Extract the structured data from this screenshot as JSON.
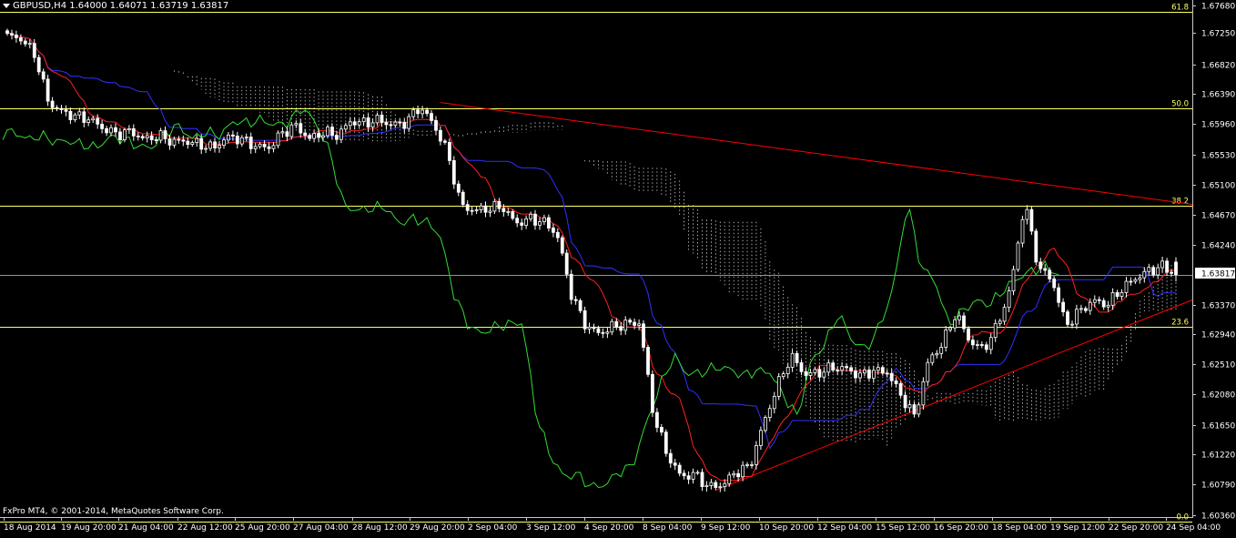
{
  "header": {
    "symbol_line": "GBPUSD,H4  1.64000 1.64071 1.63719 1.63817"
  },
  "footer": {
    "copyright": "FxPro MT4, © 2001-2014, MetaQuotes Software Corp."
  },
  "price_axis": {
    "ticks": [
      "1.67680",
      "1.67250",
      "1.66820",
      "1.66390",
      "1.65960",
      "1.65530",
      "1.65100",
      "1.64670",
      "1.64240",
      "1.63817",
      "1.63370",
      "1.62940",
      "1.62510",
      "1.62080",
      "1.61650",
      "1.61220",
      "1.60790",
      "1.60360"
    ],
    "current_price": "1.63817"
  },
  "time_axis": {
    "labels": [
      "18 Aug 2014",
      "19 Aug 20:00",
      "21 Aug 04:00",
      "22 Aug 12:00",
      "25 Aug 20:00",
      "27 Aug 04:00",
      "28 Aug 12:00",
      "29 Aug 20:00",
      "2 Sep 04:00",
      "3 Sep 12:00",
      "4 Sep 20:00",
      "8 Sep 04:00",
      "9 Sep 12:00",
      "10 Sep 20:00",
      "12 Sep 04:00",
      "15 Sep 12:00",
      "16 Sep 20:00",
      "18 Sep 04:00",
      "19 Sep 12:00",
      "22 Sep 20:00",
      "24 Sep 04:00"
    ]
  },
  "fibonacci": [
    {
      "label": "61.8",
      "price": 1.6764
    },
    {
      "label": "50.0",
      "price": 1.6623
    },
    {
      "label": "38.2",
      "price": 1.6482
    },
    {
      "label": "23.6",
      "price": 1.6306
    },
    {
      "label": "0.0",
      "price": 1.6023
    }
  ],
  "colors": {
    "background": "#000000",
    "candle": "#ffffff",
    "fibo": "#ffff66",
    "trendline": "#ff0000",
    "tenkan": "#ff2020",
    "kijun": "#3030ff",
    "chikou": "#33dd33",
    "cloud": "#ffffff",
    "current_line": "#7b93c8"
  },
  "chart_data": {
    "type": "candlestick",
    "symbol": "GBPUSD",
    "timeframe": "H4",
    "last_bar": {
      "open": 1.64,
      "high": 1.64071,
      "low": 1.63719,
      "close": 1.63817
    },
    "ylim": [
      1.6036,
      1.6789
    ],
    "close_path": [
      1.6729,
      1.6725,
      1.6702,
      1.6632,
      1.6618,
      1.6612,
      1.6608,
      1.6594,
      1.6586,
      1.659,
      1.6578,
      1.6584,
      1.6575,
      1.6576,
      1.6571,
      1.6566,
      1.6582,
      1.6579,
      1.6569,
      1.6566,
      1.6588,
      1.6598,
      1.6579,
      1.6589,
      1.6584,
      1.6605,
      1.6602,
      1.6607,
      1.6599,
      1.6603,
      1.6626,
      1.6601,
      1.656,
      1.6482,
      1.6475,
      1.6478,
      1.6481,
      1.6456,
      1.6463,
      1.6459,
      1.644,
      1.6355,
      1.631,
      1.6296,
      1.6306,
      1.631,
      1.6312,
      1.6178,
      1.612,
      1.6088,
      1.6092,
      1.6073,
      1.6076,
      1.6095,
      1.6103,
      1.6165,
      1.622,
      1.6264,
      1.6237,
      1.6239,
      1.6247,
      1.6245,
      1.6235,
      1.6242,
      1.624,
      1.6206,
      1.6175,
      1.6256,
      1.6281,
      1.6326,
      1.6285,
      1.6273,
      1.6307,
      1.6364,
      1.6488,
      1.6392,
      1.6374,
      1.6308,
      1.6329,
      1.6344,
      1.6338,
      1.636,
      1.6376,
      1.6387,
      1.6394,
      1.6382
    ]
  }
}
